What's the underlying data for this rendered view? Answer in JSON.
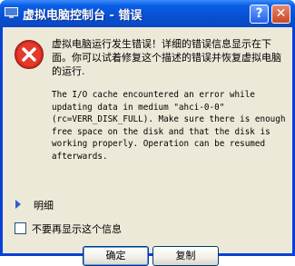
{
  "window": {
    "title": "虚拟电脑控制台 - 错误"
  },
  "titlebar_buttons": {
    "help_label": "?",
    "close_label": "✕"
  },
  "message": {
    "main": "虚拟电脑运行发生错误！详细的错误信息显示在下面。你可以试着修复这个描述的错误并恢复虚拟电脑的运行.",
    "detail": "The I/O cache encountered an error while updating data in medium \"ahci-0-0\" (rc=VERR_DISK_FULL). Make sure there is enough free space on the disk and that the disk is working properly. Operation can be resumed afterwards."
  },
  "details": {
    "label": "明细"
  },
  "checkbox": {
    "label": "不要再显示这个信息",
    "checked": false
  },
  "buttons": {
    "ok_label": "确定",
    "copy_label": "复制"
  },
  "icons": {
    "error": "error-icon",
    "title": "app-icon"
  },
  "colors": {
    "titlebar": "#0a5fe6",
    "client": "#ece9d8",
    "error_red": "#d7261d"
  }
}
